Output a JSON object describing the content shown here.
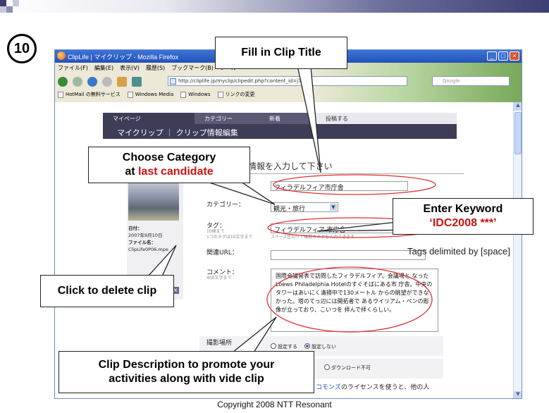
{
  "slide": {
    "step_number": "10",
    "copyright": "Copyright 2008 NTT Resonant"
  },
  "browser": {
    "title": "ClipLife | マイクリップ - Mozilla Firefox",
    "menu": [
      "ファイル(F)",
      "編集(E)",
      "表示(V)",
      "履歴(S)",
      "ブックマーク(B)",
      "ツール"
    ],
    "address": "http://cliplife.jp/myclip/clipedit.php?content_id=j7",
    "search_placeholder": "Google",
    "bookmarks": [
      "HotMail の無料サービス",
      "Windows Media",
      "Windows",
      "リンクの変更"
    ]
  },
  "page": {
    "nav_tabs": [
      "マイページ",
      "カテゴリー",
      "新着",
      "投稿する"
    ],
    "subtitle": "マイクリップ ｜ クリップ情報編集",
    "heading": "したクリップの情報を入力して下さい",
    "thumbnail": {
      "date_label": "日付：",
      "date_value": "2007年9月10日",
      "file_label": "ファイル名：",
      "file_value": "ClipLife0P06.mpe",
      "delete_label": "削除"
    },
    "form": {
      "title_value": "フィラデルフィア市庁舎",
      "category_label": "カテゴリー：",
      "category_value": "観光・旅行",
      "tags_label": "タグ：",
      "tags_sub": "10個まで\n1つのタグは10文字まで",
      "tags_value": "フィラデルフィア 市庁舎",
      "tags_hint": "スペース区切りで複数のタグを入力できます",
      "url_label": "関連URL：",
      "comment_label": "コメント：",
      "comment_sub": "400文字まで",
      "comment_value": "国際会議発表で訪問したフィラデルフィア。会議場と なったLoews Philadelphia Hotelのすぐそばにある市 庁舎。中央のタワーはあいにく清掃中で130メートル からの眺望ができなかった。塔のてっ辺には開拓者で あるウイリアム・ペンの彫像が立っており、こいつを 拝んで拝くらしい。",
      "location_label": "撮影場所",
      "location_set": "設定する",
      "location_unset": "設定しない",
      "download_no": "ダウンロード不可",
      "license_link": "コモンズ",
      "license_text": "のライセンスを使うと、他の人"
    }
  },
  "callouts": {
    "clip_title": "Fill in Clip Title",
    "category_line1": "Choose Category",
    "category_prefix": "at ",
    "category_red": "last candidate",
    "keyword_line1": "Enter Keyword",
    "keyword_red": "‘IDC2008 ***’",
    "tags_note": "Tags delimited by [space]",
    "delete_clip": "Click to delete clip",
    "description_line1": "Clip Description to promote your",
    "description_line2": "activities along with vide clip"
  },
  "colors": {
    "callout_red": "#cc1111",
    "ellipse_red": "#e03030",
    "nav_dark": "#3d3d58"
  }
}
